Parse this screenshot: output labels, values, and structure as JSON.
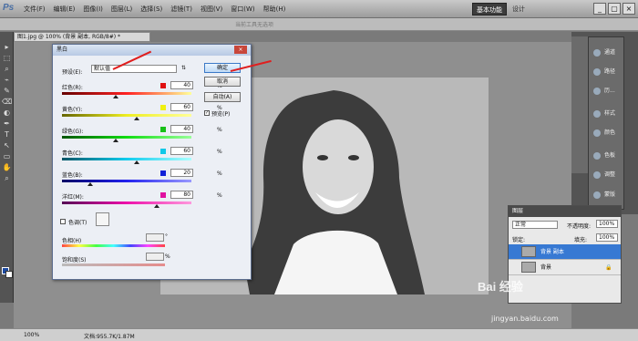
{
  "app": {
    "logo": "Ps",
    "menu": [
      "文件(F)",
      "编辑(E)",
      "图像(I)",
      "图层(L)",
      "选择(S)",
      "滤镜(T)",
      "视图(V)",
      "窗口(W)",
      "帮助(H)"
    ],
    "workspace": "基本功能",
    "design": "设计",
    "options_hint": "当前工具无选项",
    "doc_tab": "图1.jpg @ 100% (背景 副本, RGB/8#) *",
    "window_buttons": [
      "_",
      "▢",
      "×"
    ]
  },
  "dialog": {
    "title": "黑白",
    "preset_label": "预设(E):",
    "preset_value": "默认值",
    "preset_menu": "⇅",
    "sliders": [
      {
        "label": "红色(R):",
        "value": "40",
        "color": "#e01010",
        "thumb": 0.4
      },
      {
        "label": "黄色(Y):",
        "value": "60",
        "color": "#f0f010",
        "thumb": 0.6
      },
      {
        "label": "绿色(G):",
        "value": "40",
        "color": "#18c018",
        "thumb": 0.4
      },
      {
        "label": "青色(C):",
        "value": "60",
        "color": "#10c8e8",
        "thumb": 0.6
      },
      {
        "label": "蓝色(B):",
        "value": "20",
        "color": "#1020d8",
        "thumb": 0.2
      },
      {
        "label": "洋红(M):",
        "value": "80",
        "color": "#e010a0",
        "thumb": 0.8
      }
    ],
    "pct": "%",
    "buttons": [
      "确定",
      "取消",
      "自动(A)"
    ],
    "preview_label": "预览(P)",
    "preview_check": "✓",
    "tint_label": "色调(T)",
    "hue_label": "色相(H)",
    "hue_unit": "°",
    "sat_label": "饱和度(S)",
    "sat_unit": "%"
  },
  "dock": {
    "items": [
      "通道",
      "路径",
      "历...",
      "样式",
      "颜色",
      "色板",
      "调整",
      "蒙版"
    ]
  },
  "layers": {
    "title": "图层",
    "mode": "正常",
    "opacity_label": "不透明度:",
    "opacity": "100%",
    "fill_label": "填充:",
    "fill": "100%",
    "lock_label": "锁定:",
    "rows": [
      "背景 副本",
      "背景"
    ]
  },
  "status": {
    "zoom": "100%",
    "doc": "文档:955.7K/1.87M"
  },
  "watermark": {
    "brand": "Bai 经验",
    "url": "jingyan.baidu.com"
  },
  "tools": [
    "▸",
    "⬚",
    "⌕",
    "⌁",
    "✎",
    "⌫",
    "◐",
    "✒",
    "T",
    "↖",
    "▭",
    "✋",
    "⌕"
  ]
}
